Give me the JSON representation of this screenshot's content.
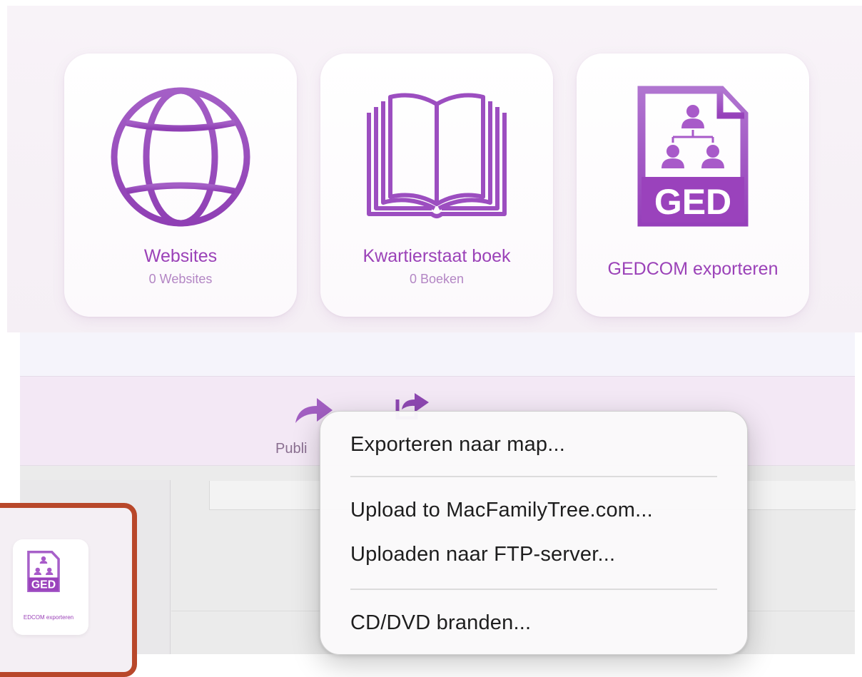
{
  "cards": [
    {
      "title": "Websites",
      "subtitle": "0 Websites",
      "icon": "globe-icon"
    },
    {
      "title": "Kwartierstaat boek",
      "subtitle": "0 Boeken",
      "icon": "open-book-icon"
    },
    {
      "title": "GEDCOM exporteren",
      "subtitle": "",
      "icon": "ged-file-icon"
    }
  ],
  "toolbar": {
    "publish_label": "Publi",
    "publish_icon": "share-arrow-icon",
    "export_icon": "export-icon"
  },
  "sidebar": {
    "mini_card_label": "EDCOM exporteren",
    "mini_card_icon_text": "GED"
  },
  "context_menu": {
    "items": [
      "Exporteren naar map...",
      "Upload to MacFamilyTree.com...",
      "Uploaden naar FTP-server...",
      "CD/DVD branden..."
    ]
  },
  "colors": {
    "accent": "#9b42b8",
    "accent_light": "#b386c4",
    "selection": "#b8472a"
  }
}
